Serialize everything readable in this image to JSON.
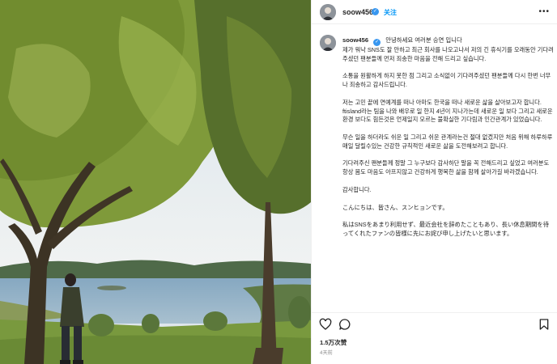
{
  "post": {
    "username": "soow456",
    "verified_symbol": "✓",
    "follow_label": "关注",
    "more_label": "•••",
    "greeting": "안녕하세요 여러분 승연 입니다",
    "paragraphs": [
      "제가 워낙 SNS도 잘 안하고 최근 회사를 나오고나서 저의 긴 휴식기를 오래동안 기다려주셨던 팬분들께 먼저 죄송한 마음을 전해 드리고 싶습니다.",
      "소통을 원활하게 하지 못한 점 그리고 소식없이 기다려주셨던 팬분들께 다시 한번 너무나 죄송하고 감사드립니다.",
      "저는 고민 끝에 연예계를 떠나 아마도 한국을 떠나 새로운 삶을 살아보고자 합니다. ftisland라는 팀을 나와 배우로 일 한지 4년이 지나가는데 새로운 일 보다 그리고 새로운 환경 보다도 힘든것은 언제일지 모르는 불확실한 기다림과 인간관계가 있었습니다.",
      "무슨 일을 하더라도 쉬운 일 그리고 쉬운 관계라는건 절대 없겠지만 처음 위해 하루하루 매일 달릴수있는 건강한 규칙적인 새로운 삶을 도전해보려고 합니다.",
      "기다려주신 팬분들께 정말 그 누구보다 감사하단 말을 꼭 전해드리고 싶었고 여러분도 항상 몸도 마음도 아프지않고 건강하게 행복한 삶을 함께 살아가길 바라겠습니다.",
      "감사합니다.",
      "こんにちは、皆さん、スンヒョンです。",
      "私はSNSをあまり利用せず、最近会社を辞めたこともあり、長い休息期間を待ってくれたファンの皆様に先にお詫び申し上げたいと思います。"
    ],
    "likes": "1.5万次赞",
    "time": "4天前"
  },
  "icons": {
    "like": "heart-icon",
    "comment": "comment-icon",
    "save": "bookmark-icon",
    "more": "more-icon"
  },
  "colors": {
    "link_blue": "#0095f6",
    "verified_blue": "#3897f0",
    "text": "#262626",
    "muted": "#8e8e8e",
    "divider": "#efefef"
  }
}
